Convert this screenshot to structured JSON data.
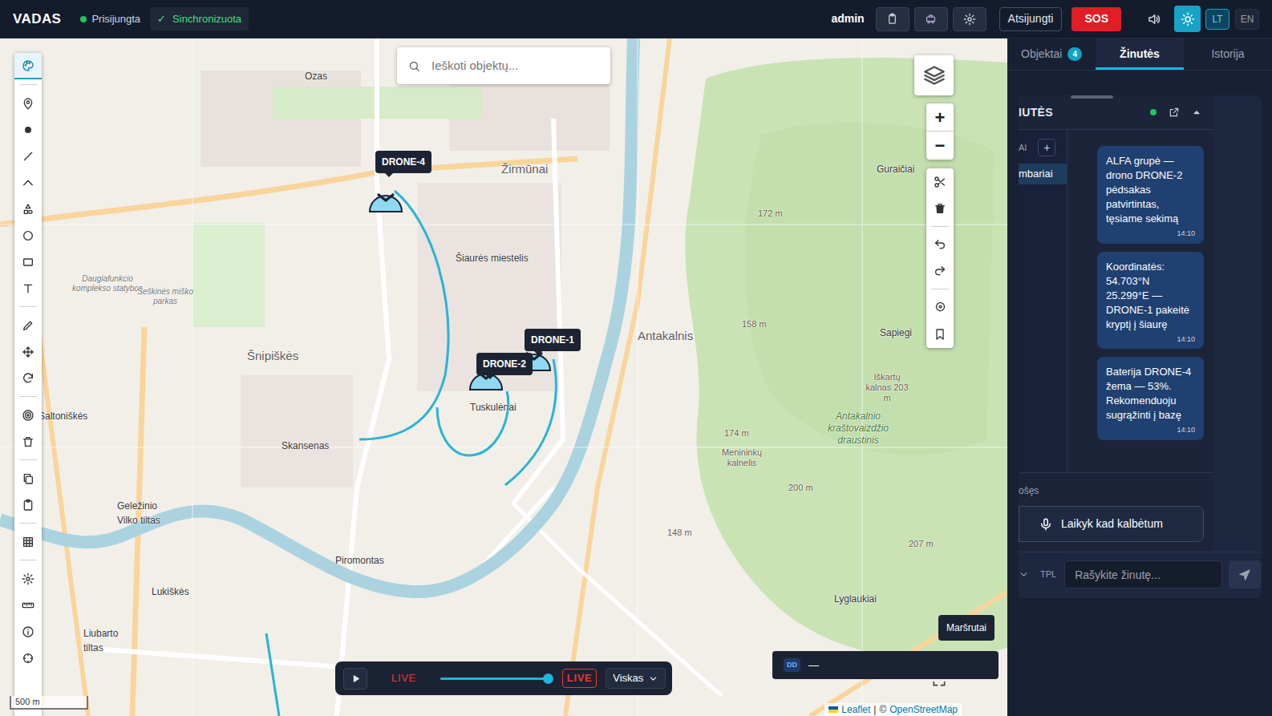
{
  "app": {
    "title": "VADAS",
    "connection": {
      "label": "Prisijungta",
      "online": true
    },
    "sync": {
      "icon": "✓",
      "label": "Sinchronizuota"
    }
  },
  "topbar": {
    "user": "admin",
    "logout": "Atsijungti",
    "sos": "SOS",
    "theme_light": true,
    "languages": [
      {
        "label": "LT",
        "selected": true
      },
      {
        "label": "EN",
        "selected": false
      }
    ]
  },
  "search": {
    "placeholder": "Ieškoti objektų..."
  },
  "toolbar": {
    "tools": [
      {
        "selected": true
      },
      {
        "selected": false
      },
      {
        "selected": false
      },
      {
        "selected": false
      },
      {
        "selected": false
      },
      {
        "selected": false
      },
      {
        "selected": false
      },
      {
        "selected": false
      },
      {
        "selected": false
      },
      {
        "selected": false
      },
      {
        "selected": false
      },
      {
        "selected": false
      },
      {
        "selected": false
      },
      {
        "selected": false
      },
      {
        "selected": false
      },
      {
        "selected": false
      },
      {
        "selected": false
      },
      {
        "selected": false
      },
      {
        "selected": false
      },
      {
        "selected": false
      },
      {
        "selected": false
      }
    ]
  },
  "map": {
    "labels": [
      {
        "text": "Ozas",
        "kind": "place"
      },
      {
        "text": "Žirmūnai",
        "kind": "district"
      },
      {
        "text": "Šiaurės miestelis",
        "kind": "place"
      },
      {
        "text": "Šnipiškės",
        "kind": "district"
      },
      {
        "text": "Antakalnis",
        "kind": "district"
      },
      {
        "text": "Tuskulėnai",
        "kind": "place"
      },
      {
        "text": "Saltoniškės",
        "kind": "place"
      },
      {
        "text": "Skansenas",
        "kind": "place"
      },
      {
        "text": "Piromontas",
        "kind": "place"
      },
      {
        "text": "Lukiškės",
        "kind": "place"
      },
      {
        "text": "Guraičiai",
        "kind": "place"
      },
      {
        "text": "Lyglaukiai",
        "kind": "place"
      },
      {
        "text": "Antakalnio kraštovaizdžio draustinis",
        "kind": "park"
      },
      {
        "text": "Geležinio Vilko tiltas",
        "kind": "place"
      },
      {
        "text": "Liubarto tiltas",
        "kind": "place"
      },
      {
        "text": "Daugiafunkcio komplekso statybos",
        "kind": "note"
      },
      {
        "text": "Šeškinės miško parkas",
        "kind": "note"
      },
      {
        "text": "Sapiegi",
        "kind": "place"
      },
      {
        "text": "Iškartų kalnas 203 m",
        "kind": "elevation"
      },
      {
        "text": "Menininkų kalnelis",
        "kind": "elevation"
      },
      {
        "text": "172 m",
        "kind": "elevation"
      },
      {
        "text": "158 m",
        "kind": "elevation"
      },
      {
        "text": "174 m",
        "kind": "elevation"
      },
      {
        "text": "200 m",
        "kind": "elevation"
      },
      {
        "text": "148 m",
        "kind": "elevation"
      },
      {
        "text": "207 m",
        "kind": "elevation"
      }
    ],
    "drones": [
      {
        "label": "DRONE-4"
      },
      {
        "label": "DRONE-1"
      },
      {
        "label": "DRONE-2"
      }
    ],
    "zoom": {
      "in": "+",
      "out": "−"
    },
    "tooltip": "Maršrutai",
    "coords": {
      "format": "DD",
      "value": "—"
    },
    "scale": "500 m",
    "attribution": {
      "leaflet": "Leaflet",
      "separator": "|",
      "copyright": "©",
      "osm": "OpenStreetMap"
    }
  },
  "timeline": {
    "playing": false,
    "live_label": "LIVE",
    "level": 1,
    "live_badge": "LIVE",
    "filter": "Viskas"
  },
  "panel": {
    "tabs": [
      {
        "label": "Objektai",
        "badge": "4",
        "selected": false
      },
      {
        "label": "Žinutės",
        "selected": true
      },
      {
        "label": "Istorija",
        "selected": false
      }
    ],
    "chat": {
      "title": "IUTĖS",
      "online": true,
      "channels_header": "AI",
      "channels_add": "+",
      "channels": [
        {
          "label": "mbariai",
          "selected": true
        }
      ],
      "messages": [
        {
          "text": "ALFA grupė — drono DRONE-2 pėdsakas patvirtintas, tęsiame sekimą",
          "time": "14:10"
        },
        {
          "text": "Koordinatės: 54.703°N 25.299°E — DRONE-1 pakeitė kryptį į šiaurę",
          "time": "14:10"
        },
        {
          "text": "Baterija DRONE-4 žema — 53%. Rekomenduoju sugrąžinti į bazę",
          "time": "14:10"
        }
      ],
      "voice_label": "ošęs",
      "voice_button": "Laikyk kad kalbėtum",
      "template": "TPL",
      "input_placeholder": "Rašykite žinutę..."
    }
  }
}
